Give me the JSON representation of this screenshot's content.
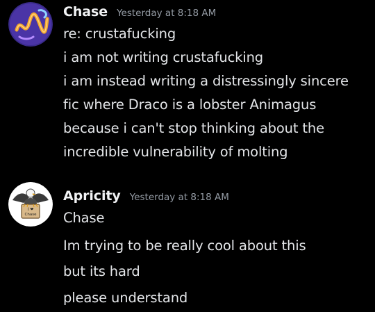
{
  "messages": [
    {
      "username": "Chase",
      "timestamp": "Yesterday at 8:18 AM",
      "avatar_icon": "purple-squiggle-avatar",
      "username_color": "#f2f3f5",
      "lines": [
        "re: crustafucking",
        "i am not writing crustafucking",
        "i am instead writing a distressingly sincere",
        "fic where Draco is a lobster Animagus",
        "because i can't stop thinking about the",
        "incredible vulnerability of molting"
      ]
    },
    {
      "username": "Apricity",
      "timestamp": "Yesterday at 8:18 AM",
      "avatar_icon": "eagle-sign-avatar",
      "avatar_sign_text": "I ❤ Chase",
      "lines": [
        "Chase",
        "Im trying to be really cool about this",
        "but its hard",
        "please understand"
      ]
    }
  ],
  "colors": {
    "background": "#000000",
    "text": "#e3e5e8",
    "timestamp": "#949ba4",
    "avatar1_bg": "#3b2a8c",
    "avatar1_accent": "#f0a030"
  }
}
